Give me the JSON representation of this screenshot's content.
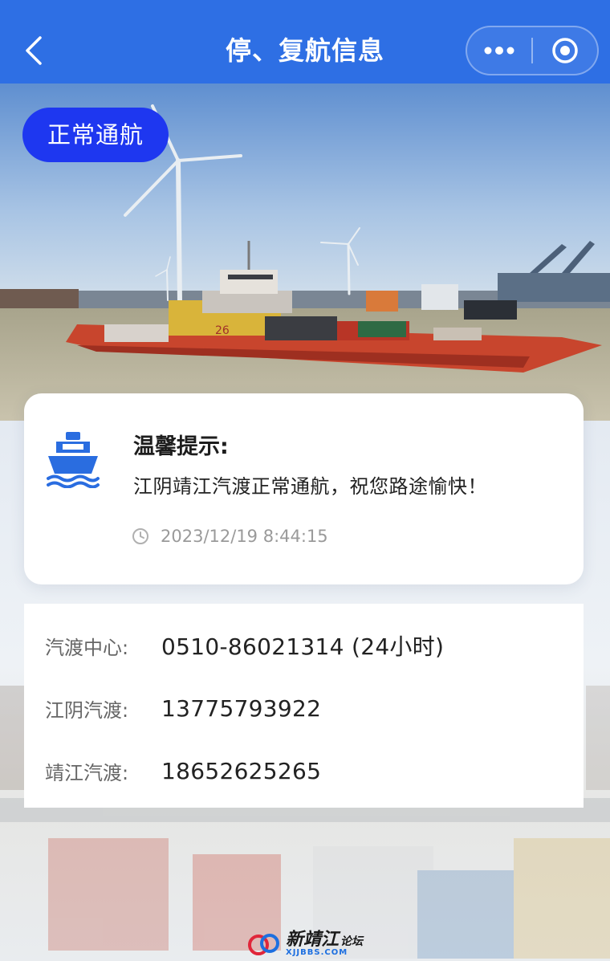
{
  "nav": {
    "title": "停、复航信息",
    "back_icon": "chevron-left-icon",
    "more_icon": "more-dots-icon",
    "close_icon": "target-circle-icon"
  },
  "hero": {
    "status_badge": "正常通航",
    "badge_color": "#1e37f0",
    "ferry_number": "26"
  },
  "notice": {
    "title": "温馨提示:",
    "message": "江阴靖江汽渡正常通航，祝您路途愉快！",
    "timestamp": "2023/12/19 8:44:15",
    "icon": "ship-icon",
    "icon_color": "#2a6de0"
  },
  "contacts": [
    {
      "label": "汽渡中心:",
      "value": "0510-86021314 (24小时)"
    },
    {
      "label": "江阴汽渡:",
      "value": "13775793922"
    },
    {
      "label": "靖江汽渡:",
      "value": "18652625265"
    }
  ],
  "watermark": {
    "main": "新靖江",
    "suffix": "论坛",
    "domain": "XJJBBS.COM"
  },
  "colors": {
    "navbar": "#2e6fe4",
    "accent": "#1e37f0"
  }
}
